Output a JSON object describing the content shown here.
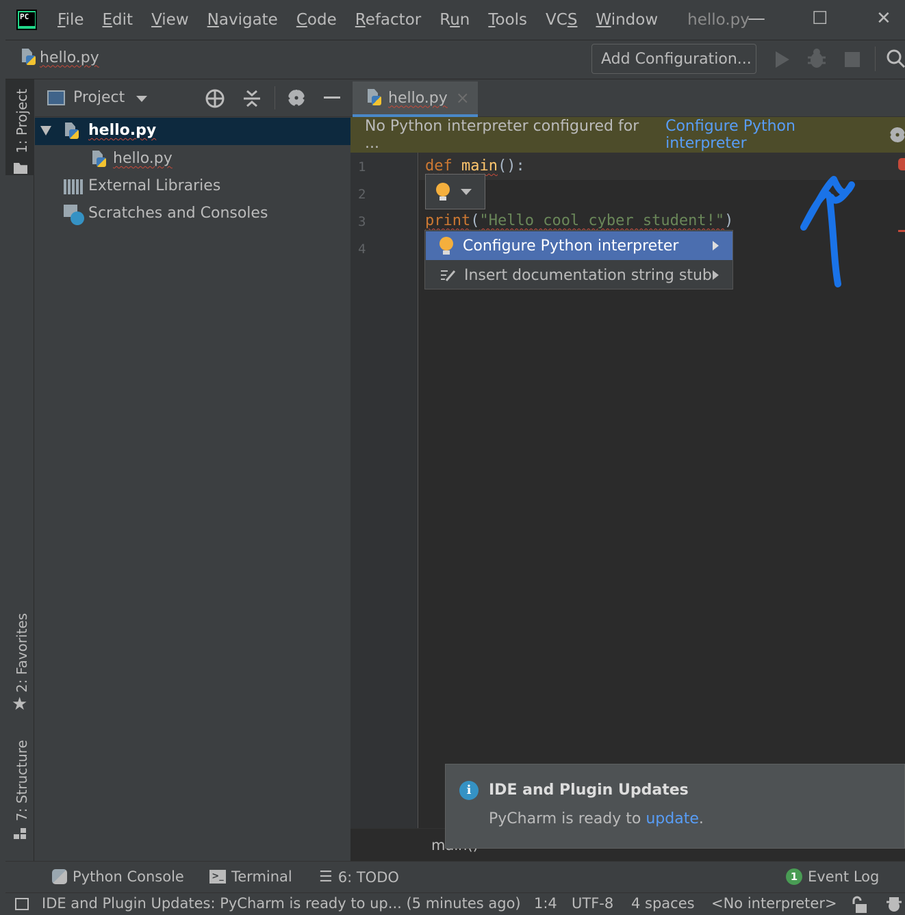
{
  "menubar": {
    "items": [
      {
        "label": "File",
        "mnemonic": "F"
      },
      {
        "label": "Edit",
        "mnemonic": "E"
      },
      {
        "label": "View",
        "mnemonic": "V"
      },
      {
        "label": "Navigate",
        "mnemonic": "N"
      },
      {
        "label": "Code",
        "mnemonic": "C"
      },
      {
        "label": "Refactor",
        "mnemonic": "R"
      },
      {
        "label": "Run",
        "mnemonic": "u"
      },
      {
        "label": "Tools",
        "mnemonic": "T"
      },
      {
        "label": "VCS",
        "mnemonic": "S"
      },
      {
        "label": "Window",
        "mnemonic": "W"
      }
    ],
    "window_title": "hello.py",
    "minimize": "—",
    "maximize": "☐",
    "close": "✕"
  },
  "navbar": {
    "file": "hello.py",
    "add_configuration": "Add Configuration..."
  },
  "left_stripe": {
    "project_tab": "1: Project",
    "favorites_tab": "2: Favorites",
    "structure_tab": "7: Structure"
  },
  "project_panel": {
    "title": "Project",
    "tree": {
      "root": "hello.py",
      "child": "hello.py",
      "external_libraries": "External Libraries",
      "scratches": "Scratches and Consoles"
    }
  },
  "editor": {
    "tab_label": "hello.py",
    "tab_close": "×",
    "banner_text": "No Python interpreter configured for ...",
    "banner_link": "Configure Python interpreter",
    "line_numbers": [
      "1",
      "2",
      "3",
      "4"
    ],
    "code": {
      "line1_kw": "def",
      "line1_fn": "main",
      "line1_rest": "():",
      "line3_builtin": "print",
      "line3_open": "(",
      "line3_str": "\"Hello cool cyber student!\"",
      "line3_close": ")"
    },
    "intentions": [
      {
        "label": "Configure Python interpreter"
      },
      {
        "label": "Insert documentation string stub"
      }
    ],
    "breadcrumb": "main()"
  },
  "notification": {
    "title": "IDE and Plugin Updates",
    "body_prefix": "PyCharm is ready to ",
    "body_link": "update",
    "body_suffix": "."
  },
  "tool_stripe": {
    "python_console": "Python Console",
    "terminal": "Terminal",
    "todo": "6: TODO",
    "event_log": "Event Log",
    "event_log_count": "1"
  },
  "status_bar": {
    "message": "IDE and Plugin Updates: PyCharm is ready to up... (5 minutes ago)",
    "position": "1:4",
    "encoding": "UTF-8",
    "indent": "4 spaces",
    "interpreter": "<No interpreter>"
  },
  "colors": {
    "background": "#3c3f41",
    "editor_bg": "#2b2b2b",
    "selection": "#0d293e",
    "accent_link": "#589df6",
    "popup_selected": "#4b6eaf",
    "keyword": "#cc7832",
    "function": "#ffc66d",
    "string": "#6a8759",
    "annotation_arrow": "#1a73e8"
  }
}
